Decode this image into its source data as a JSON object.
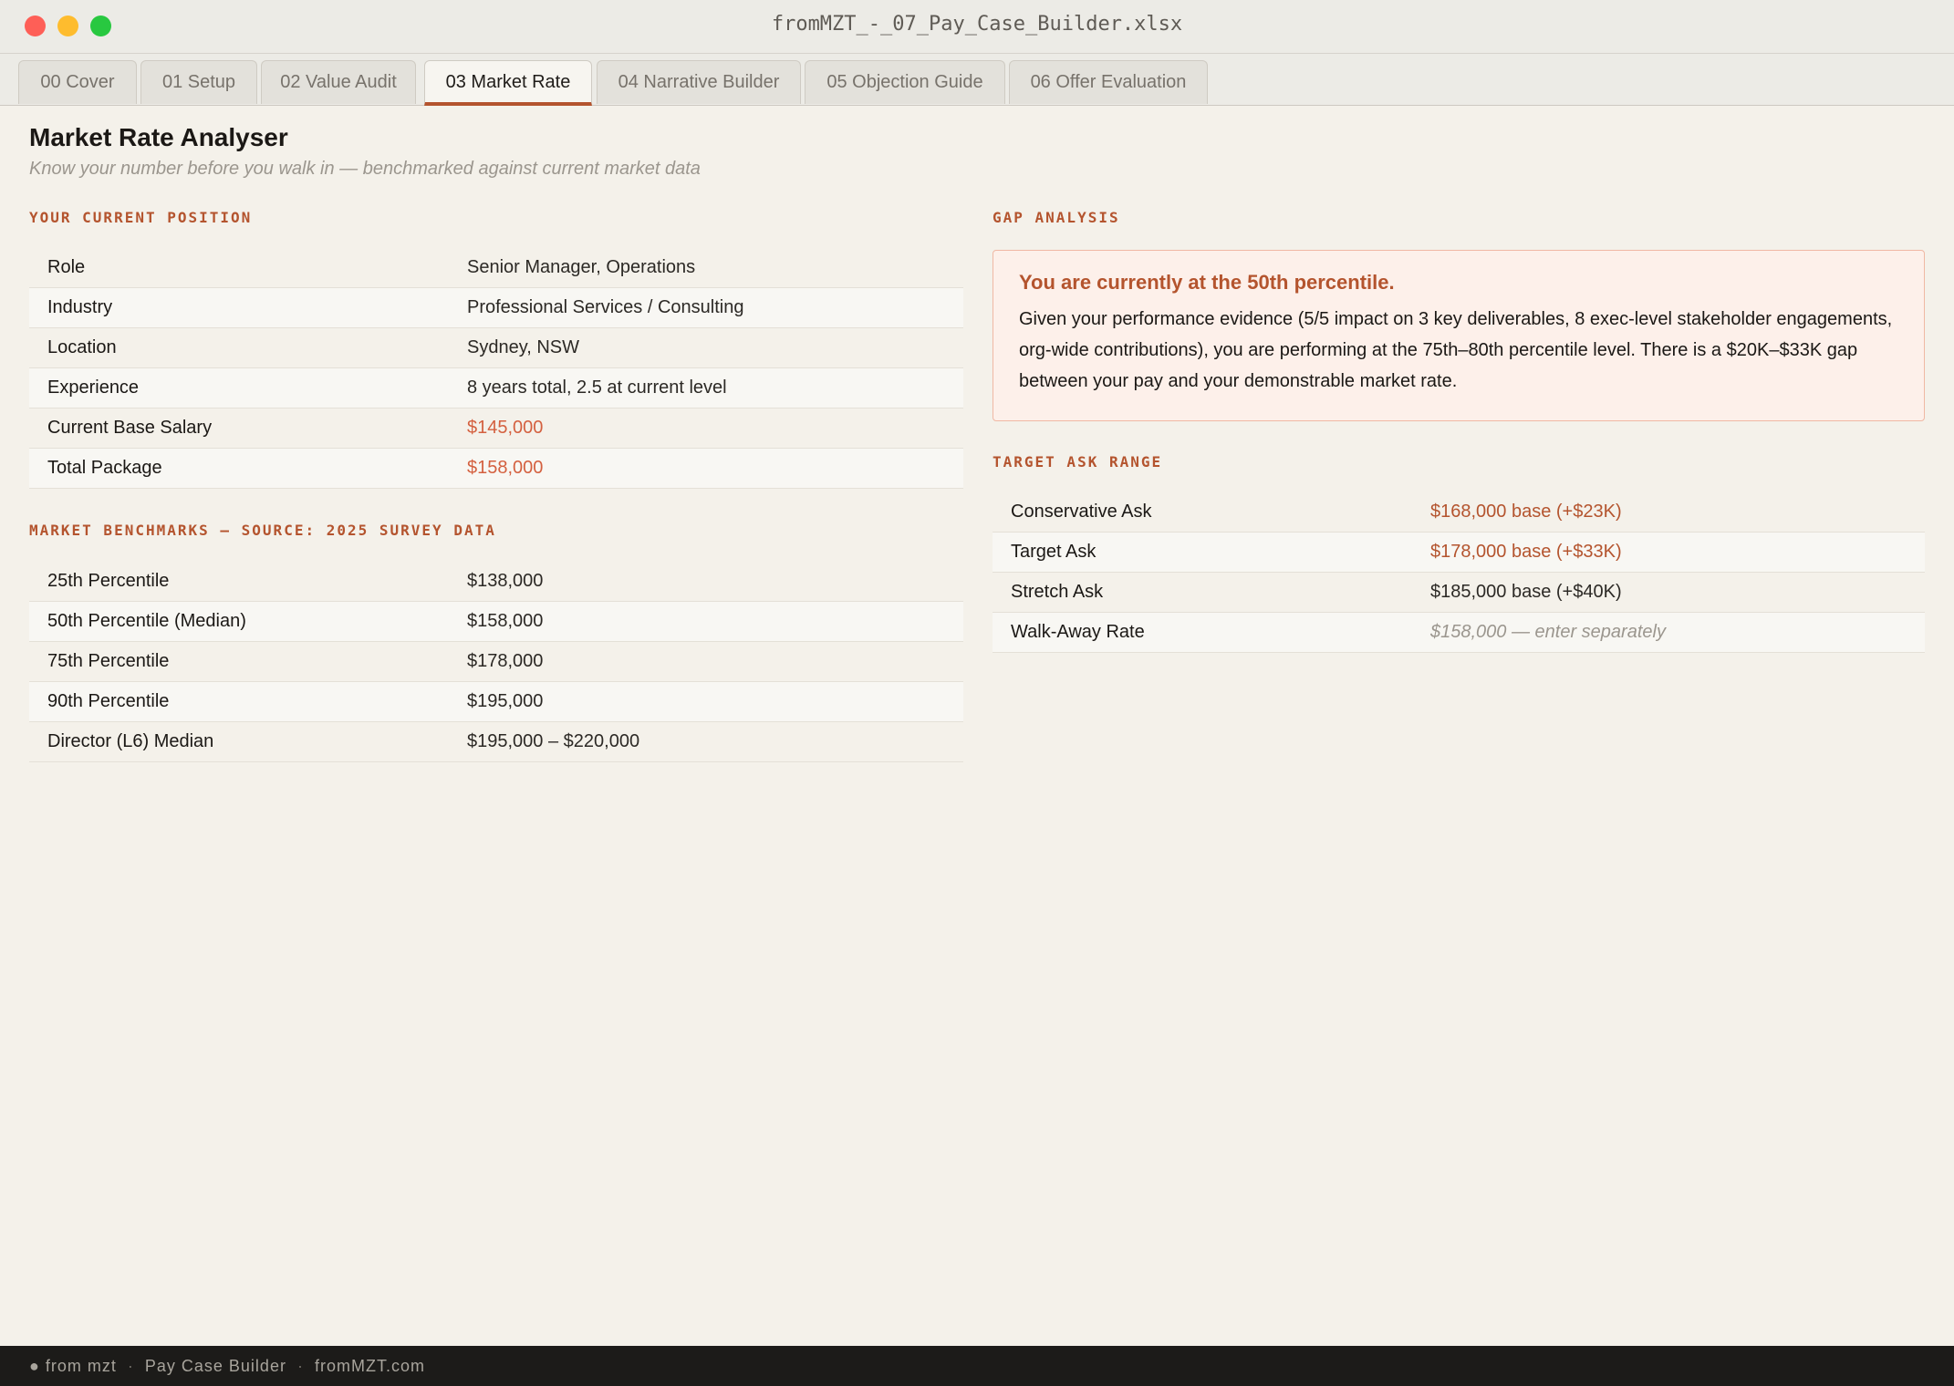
{
  "window": {
    "title": "fromMZT_-_07_Pay_Case_Builder.xlsx"
  },
  "tabs": [
    {
      "label": "00 Cover"
    },
    {
      "label": "01 Setup"
    },
    {
      "label": "02 Value Audit"
    },
    {
      "label": "03 Market Rate"
    },
    {
      "label": "04 Narrative Builder"
    },
    {
      "label": "05 Objection Guide"
    },
    {
      "label": "06 Offer Evaluation"
    }
  ],
  "active_tab": "03 Market Rate",
  "page": {
    "title": "Market Rate Analyser",
    "subtitle": "Know your number before you walk in — benchmarked against current market data"
  },
  "current_position": {
    "heading": "YOUR CURRENT POSITION",
    "rows": [
      {
        "label": "Role",
        "value": "Senior Manager, Operations"
      },
      {
        "label": "Industry",
        "value": "Professional Services / Consulting"
      },
      {
        "label": "Location",
        "value": "Sydney, NSW"
      },
      {
        "label": "Experience",
        "value": "8 years total, 2.5 at current level"
      },
      {
        "label": "Current Base Salary",
        "value": "$145,000"
      },
      {
        "label": "Total Package",
        "value": "$158,000"
      }
    ]
  },
  "market_benchmarks": {
    "heading": "MARKET BENCHMARKS — SOURCE: 2025 SURVEY DATA",
    "rows": [
      {
        "label": "25th Percentile",
        "value": "$138,000"
      },
      {
        "label": "50th Percentile (Median)",
        "value": "$158,000"
      },
      {
        "label": "75th Percentile",
        "value": "$178,000"
      },
      {
        "label": "90th Percentile",
        "value": "$195,000"
      },
      {
        "label": "Director (L6) Median",
        "value": "$195,000 – $220,000"
      }
    ]
  },
  "gap_analysis": {
    "heading": "GAP ANALYSIS",
    "headline": "You are currently at the 50th percentile.",
    "body": "Given your performance evidence (5/5 impact on 3 key deliverables, 8 exec-level stakeholder engagements, org-wide contributions), you are performing at the 75th–80th percentile level. There is a $20K–$33K gap between your pay and your demonstrable market rate."
  },
  "target_ask": {
    "heading": "TARGET ASK RANGE",
    "rows": [
      {
        "label": "Conservative Ask",
        "value": "$168,000 base (+$23K)"
      },
      {
        "label": "Target Ask",
        "value": "$178,000 base (+$33K)"
      },
      {
        "label": "Stretch Ask",
        "value": "$185,000 base (+$40K)"
      },
      {
        "label": "Walk-Away Rate",
        "value": "$158,000 — enter separately"
      }
    ]
  },
  "footer": {
    "brand": "● from mzt",
    "product": "Pay Case Builder",
    "site": "fromMZT.com"
  },
  "colors": {
    "accent": "#b4542e",
    "salary_highlight": "#d4603f",
    "background": "#f4f1ea",
    "gap_box_bg": "#fdf0ea",
    "footer_bg": "#1c1b19"
  }
}
